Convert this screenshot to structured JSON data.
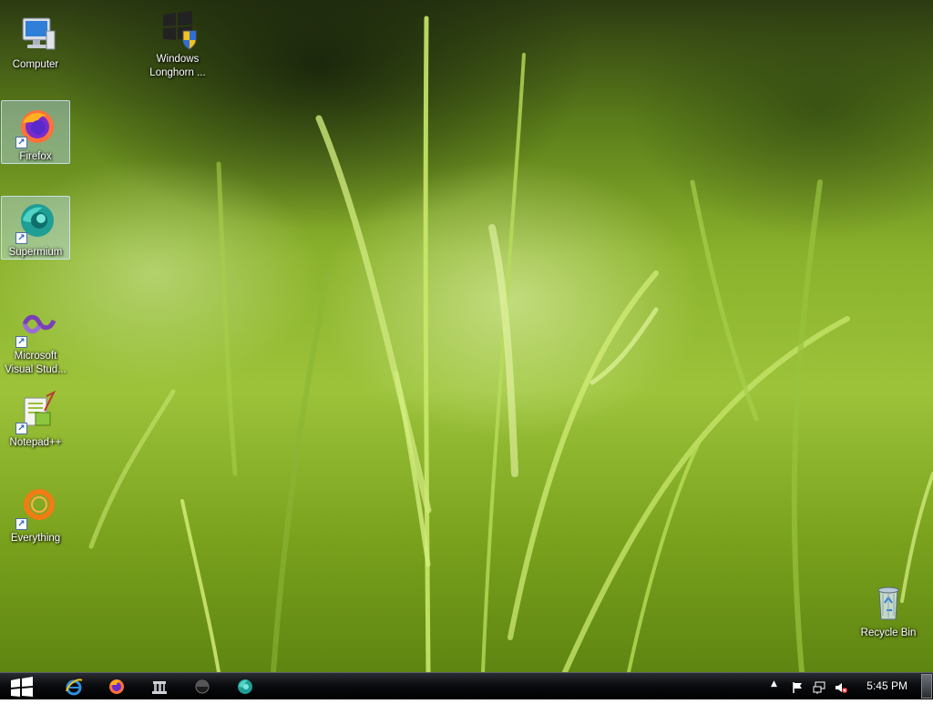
{
  "desktop": {
    "wallpaper": "green-grass",
    "icons": [
      {
        "name": "Computer",
        "label": "Computer",
        "icon": "computer-icon"
      },
      {
        "name": "Windows Longhorn",
        "label": "Windows Longhorn ...",
        "icon": "windows-shield-icon"
      },
      {
        "name": "Firefox",
        "label": "Firefox",
        "icon": "firefox-icon",
        "selected": true
      },
      {
        "name": "Supermium",
        "label": "Supermium",
        "icon": "supermium-icon",
        "selected": true
      },
      {
        "name": "Microsoft Visual Studio",
        "label": "Microsoft Visual Stud...",
        "icon": "visual-studio-icon"
      },
      {
        "name": "Notepad++",
        "label": "Notepad++",
        "icon": "notepadpp-icon"
      },
      {
        "name": "Everything",
        "label": "Everything",
        "icon": "everything-icon"
      },
      {
        "name": "Recycle Bin",
        "label": "Recycle Bin",
        "icon": "recycle-bin-icon"
      }
    ]
  },
  "taskbar": {
    "start": "start-orb-icon",
    "pinned": [
      "internet-explorer-icon",
      "firefox-icon",
      "library-icon",
      "media-icon",
      "supermium-icon"
    ],
    "tray": {
      "overflow": "▲",
      "icons": [
        "action-center-flag-icon",
        "network-icon",
        "volume-muted-icon"
      ],
      "clock": "5:45 PM"
    }
  },
  "colors": {
    "taskbar": "#000000",
    "label_text": "#ffffff",
    "selection": "#b4d7eb"
  }
}
